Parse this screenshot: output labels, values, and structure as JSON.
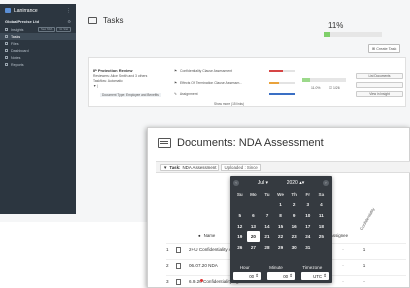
{
  "sidebar": {
    "brand": "Lanirrance",
    "org": "GlobalPrecise Ltd",
    "items": [
      {
        "label": "Insights",
        "pills": [
          "New NDA",
          "Gl. Stat"
        ]
      },
      {
        "label": "Tasks",
        "active": true
      },
      {
        "label": "Files"
      },
      {
        "label": "Dashboard"
      },
      {
        "label": "Notes"
      },
      {
        "label": "Reports"
      }
    ]
  },
  "tasks": {
    "title": "Tasks",
    "completion": "11%",
    "completion_fraction": 0.11,
    "create_button": "Create Task",
    "card": {
      "title": "IP Protection Review",
      "reviewers": "Reviewers: Alice Smith and 3 others",
      "taskflow": "Taskflow: Automatic",
      "marker": "▼ |",
      "tag": "Document Type: Employee and Benefits",
      "subtasks": [
        {
          "icon": "⚑",
          "label": "Confidentiality Clause Assessment"
        },
        {
          "icon": "⚑",
          "label": "Effects Of Termination Clause Assessm..."
        },
        {
          "icon": "✎",
          "label": "Assignment"
        }
      ],
      "stat_left": "11.0%",
      "stat_right": "☑ 1/26",
      "actions": [
        "List Documents",
        "",
        "View in Insight"
      ],
      "show_more": "Show more (15 links)"
    }
  },
  "documents": {
    "title": "Documents: NDA Assessment",
    "filter_label": "Task:",
    "filter_value": "NDA Assessment",
    "uploaded_label": "Uploaded : Since",
    "columns": {
      "name": "Name",
      "assignee": "Assignee",
      "confidentiality": "Confidentiality"
    },
    "rows": [
      {
        "num": "1",
        "name": "2+U Confidentiality Agreement",
        "dash": "-",
        "count": "1"
      },
      {
        "num": "2",
        "name": "06.07.20 NDA",
        "dash": "-",
        "count": "1"
      },
      {
        "num": "3",
        "name": "6.9.20 Confidentiality Agreem...",
        "dash": "-",
        "count": "-"
      }
    ]
  },
  "datepicker": {
    "month": "Jul",
    "year": "2020",
    "prev": "‹",
    "next": "›",
    "weekdays": [
      "Su",
      "Mo",
      "Tu",
      "We",
      "Th",
      "Fr",
      "Sa"
    ],
    "weeks": [
      [
        "",
        "",
        "",
        "1",
        "2",
        "3",
        "4"
      ],
      [
        "5",
        "6",
        "7",
        "8",
        "9",
        "10",
        "11"
      ],
      [
        "12",
        "13",
        "14",
        "15",
        "16",
        "17",
        "18"
      ],
      [
        "19",
        "20",
        "21",
        "22",
        "23",
        "24",
        "25"
      ],
      [
        "26",
        "27",
        "28",
        "29",
        "30",
        "31",
        ""
      ]
    ],
    "selected_day": "20",
    "hour_label": "Hour",
    "minute_label": "Minute",
    "timezone_label": "Timezone",
    "hour_value": "00",
    "minute_value": "00",
    "timezone_value": "UTC"
  }
}
